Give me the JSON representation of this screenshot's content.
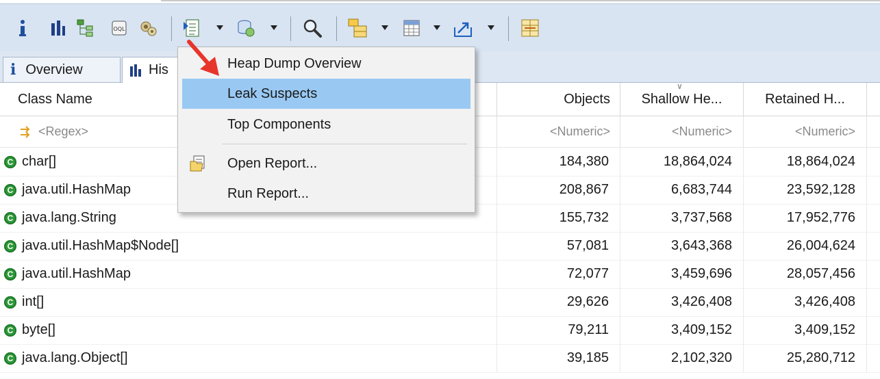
{
  "toolbar": {
    "icons": [
      "info-icon",
      "histogram-icon",
      "dominator-tree-icon",
      "oql-icon",
      "thread-overview-icon",
      "reports-dropdown-icon",
      "query-browser-icon",
      "search-icon",
      "group-by-icon",
      "calculate-icon",
      "export-icon",
      "compare-icon"
    ]
  },
  "tabs": [
    {
      "icon": "i",
      "label": "Overview"
    },
    {
      "icon": "histogram",
      "label": "His"
    }
  ],
  "menu": {
    "items": [
      {
        "label": "Heap Dump Overview",
        "selected": false
      },
      {
        "label": "Leak Suspects",
        "selected": true
      },
      {
        "label": "Top Components",
        "selected": false
      },
      {
        "label": "Open Report...",
        "selected": false,
        "icon": "open-report-icon"
      },
      {
        "label": "Run Report...",
        "selected": false
      }
    ]
  },
  "table": {
    "headers": {
      "class_name": "Class Name",
      "objects": "Objects",
      "shallow": "Shallow He...",
      "retained": "Retained H..."
    },
    "filters": {
      "class_name": "<Regex>",
      "objects": "<Numeric>",
      "shallow": "<Numeric>",
      "retained": "<Numeric>"
    },
    "rows": [
      {
        "name": "char[]",
        "objects": "184,380",
        "shallow": "18,864,024",
        "retained": "18,864,024"
      },
      {
        "name": "java.util.HashMap",
        "objects": "208,867",
        "shallow": "6,683,744",
        "retained": "23,592,128"
      },
      {
        "name": "java.lang.String",
        "objects": "155,732",
        "shallow": "3,737,568",
        "retained": "17,952,776"
      },
      {
        "name": "java.util.HashMap$Node[]",
        "objects": "57,081",
        "shallow": "3,643,368",
        "retained": "26,004,624"
      },
      {
        "name": "java.util.HashMap",
        "objects": "72,077",
        "shallow": "3,459,696",
        "retained": "28,057,456"
      },
      {
        "name": "int[]",
        "objects": "29,626",
        "shallow": "3,426,408",
        "retained": "3,426,408"
      },
      {
        "name": "byte[]",
        "objects": "79,211",
        "shallow": "3,409,152",
        "retained": "3,409,152"
      },
      {
        "name": "java.lang.Object[]",
        "objects": "39,185",
        "shallow": "2,102,320",
        "retained": "25,280,712"
      }
    ]
  },
  "colors": {
    "toolbar_bg": "#d8e4f2",
    "selection": "#99c9f3",
    "class_icon": "#2f9a3a",
    "arrow": "#e8352b"
  }
}
